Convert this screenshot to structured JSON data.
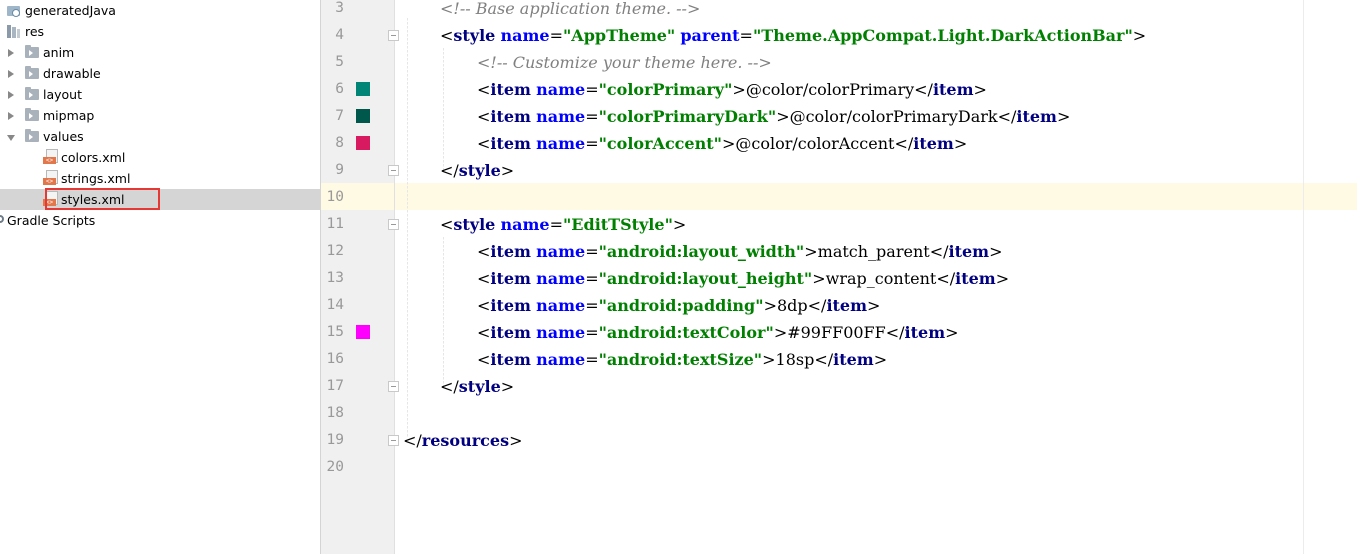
{
  "tree": {
    "items": [
      {
        "label": "generatedJava",
        "icon": "generated-java-icon"
      },
      {
        "label": "res",
        "icon": "res-folder-icon"
      },
      {
        "label": "anim",
        "icon": "folder-icon"
      },
      {
        "label": "drawable",
        "icon": "folder-icon"
      },
      {
        "label": "layout",
        "icon": "folder-icon"
      },
      {
        "label": "mipmap",
        "icon": "folder-icon"
      },
      {
        "label": "values",
        "icon": "folder-icon"
      },
      {
        "label": "colors.xml",
        "icon": "xml-file-icon"
      },
      {
        "label": "strings.xml",
        "icon": "xml-file-icon"
      },
      {
        "label": "styles.xml",
        "icon": "xml-file-icon",
        "selected": true
      },
      {
        "label": "Gradle Scripts",
        "icon": "gradle-icon"
      }
    ],
    "xml_badge": "<>"
  },
  "editor": {
    "line_numbers": [
      "3",
      "4",
      "5",
      "6",
      "7",
      "8",
      "9",
      "10",
      "11",
      "12",
      "13",
      "14",
      "15",
      "16",
      "17",
      "18",
      "19",
      "20"
    ],
    "current_line": "10",
    "swatch_colors": {
      "6": "#008577",
      "7": "#00574B",
      "8": "#D81B60",
      "15": "#FF00FF"
    },
    "lines": {
      "l3": {
        "comment": "<!-- Base application theme. -->"
      },
      "l4": {
        "open": "<",
        "tag": "style",
        "a1": "name",
        "eq1": "=",
        "v1": "\"AppTheme\"",
        "a2": "parent",
        "eq2": "=",
        "v2": "\"Theme.AppCompat.Light.DarkActionBar\"",
        "close": ">"
      },
      "l5": {
        "comment": "<!-- Customize your theme here. -->"
      },
      "l6": {
        "open": "<",
        "tag": "item",
        "a1": "name",
        "eq1": "=",
        "v1": "\"colorPrimary\"",
        "close1": ">",
        "text": "@color/colorPrimary",
        "end_open": "</",
        "end_tag": "item",
        "end_close": ">"
      },
      "l7": {
        "open": "<",
        "tag": "item",
        "a1": "name",
        "eq1": "=",
        "v1": "\"colorPrimaryDark\"",
        "close1": ">",
        "text": "@color/colorPrimaryDark",
        "end_open": "</",
        "end_tag": "item",
        "end_close": ">"
      },
      "l8": {
        "open": "<",
        "tag": "item",
        "a1": "name",
        "eq1": "=",
        "v1": "\"colorAccent\"",
        "close1": ">",
        "text": "@color/colorAccent",
        "end_open": "</",
        "end_tag": "item",
        "end_close": ">"
      },
      "l9": {
        "end_open": "</",
        "end_tag": "style",
        "end_close": ">"
      },
      "l11": {
        "open": "<",
        "tag": "style",
        "a1": "name",
        "eq1": "=",
        "v1": "\"EditTStyle\"",
        "close": ">"
      },
      "l12": {
        "open": "<",
        "tag": "item",
        "a1": "name",
        "eq1": "=",
        "v1": "\"android:layout_width\"",
        "close1": ">",
        "text": "match_parent",
        "end_open": "</",
        "end_tag": "item",
        "end_close": ">"
      },
      "l13": {
        "open": "<",
        "tag": "item",
        "a1": "name",
        "eq1": "=",
        "v1": "\"android:layout_height\"",
        "close1": ">",
        "text": "wrap_content",
        "end_open": "</",
        "end_tag": "item",
        "end_close": ">"
      },
      "l14": {
        "open": "<",
        "tag": "item",
        "a1": "name",
        "eq1": "=",
        "v1": "\"android:padding\"",
        "close1": ">",
        "text": "8dp",
        "end_open": "</",
        "end_tag": "item",
        "end_close": ">"
      },
      "l15": {
        "open": "<",
        "tag": "item",
        "a1": "name",
        "eq1": "=",
        "v1": "\"android:textColor\"",
        "close1": ">",
        "text": "#99FF00FF",
        "end_open": "</",
        "end_tag": "item",
        "end_close": ">"
      },
      "l16": {
        "open": "<",
        "tag": "item",
        "a1": "name",
        "eq1": "=",
        "v1": "\"android:textSize\"",
        "close1": ">",
        "text": "18sp",
        "end_open": "</",
        "end_tag": "item",
        "end_close": ">"
      },
      "l17": {
        "end_open": "</",
        "end_tag": "style",
        "end_close": ">"
      },
      "l19": {
        "end_open": "</",
        "end_tag": "resources",
        "end_close": ">"
      }
    }
  }
}
